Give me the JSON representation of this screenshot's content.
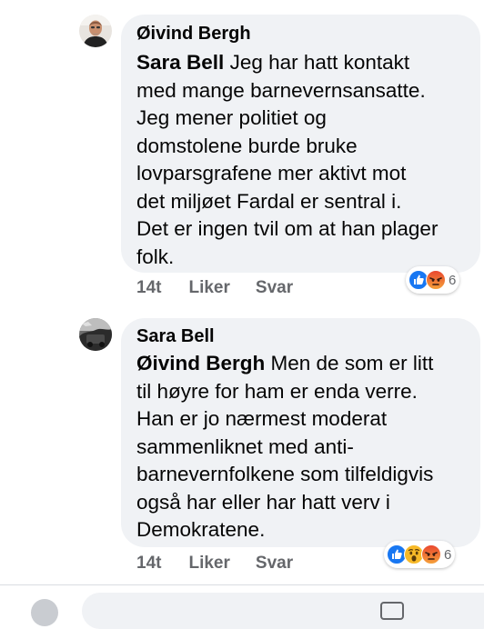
{
  "comments": [
    {
      "author": "Øivind Bergh",
      "mention": "Sara Bell",
      "lines": [
        " Jeg har hatt kontakt",
        "med mange barnevernsansatte.",
        "Jeg mener politiet og",
        "domstolene burde bruke",
        "lovparsgrafene mer aktivt mot",
        "det miljøet Fardal er sentral i.",
        "Det er ingen tvil om at han plager",
        "folk."
      ],
      "time": "14t",
      "like_label": "Liker",
      "reply_label": "Svar",
      "reactions": [
        "like",
        "angry"
      ],
      "reaction_count": "6"
    },
    {
      "author": "Sara Bell",
      "mention": "Øivind Bergh",
      "lines": [
        " Men de som er litt",
        "til høyre for ham er enda verre.",
        "Han er jo nærmest moderat",
        "sammenliknet med anti-",
        "barnevernfolkene som tilfeldigvis",
        "også har eller har hatt verv i",
        "Demokratene."
      ],
      "time": "14t",
      "like_label": "Liker",
      "reply_label": "Svar",
      "reactions": [
        "like",
        "wow",
        "angry"
      ],
      "reaction_count": "6"
    }
  ],
  "colors": {
    "bubble": "#f0f2f5",
    "like": "#1877f2",
    "angry": "#f15c3c",
    "wow": "#f7b928",
    "secondary_text": "#65676b"
  }
}
